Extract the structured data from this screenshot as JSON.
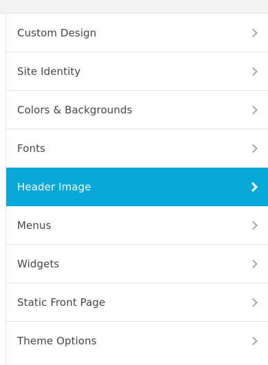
{
  "menu": {
    "items": [
      {
        "label": "Custom Design"
      },
      {
        "label": "Site Identity"
      },
      {
        "label": "Colors & Backgrounds"
      },
      {
        "label": "Fonts"
      },
      {
        "label": "Header Image"
      },
      {
        "label": "Menus"
      },
      {
        "label": "Widgets"
      },
      {
        "label": "Static Front Page"
      },
      {
        "label": "Theme Options"
      }
    ],
    "active_item": "Header Image"
  },
  "colors": {
    "active_background": "#08a9d8",
    "active_text": "#ffffff",
    "text": "#444444",
    "chevron": "#a0a7ad"
  }
}
